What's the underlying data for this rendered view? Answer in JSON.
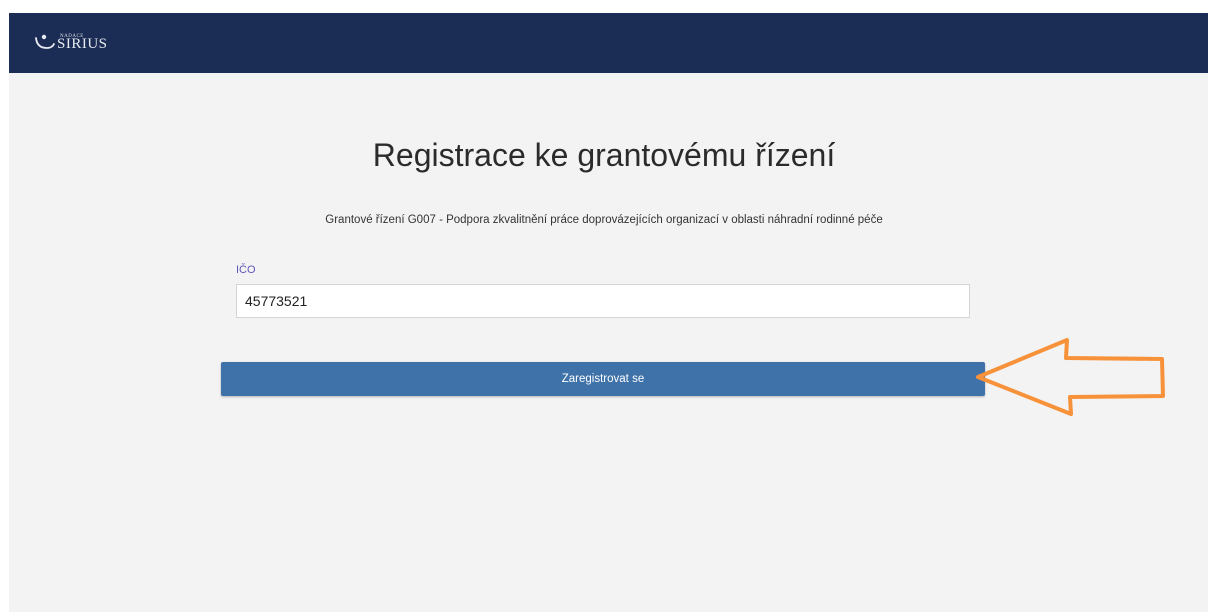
{
  "header": {
    "logo_small": "NADACE",
    "logo_main": "SIRIUS",
    "bg_color": "#1c2d55"
  },
  "main": {
    "title": "Registrace ke grantovému řízení",
    "subtitle": "Grantové řízení G007 - Podpora zkvalitnění práce doprovázejících organizací v oblasti náhradní rodinné péče",
    "ico_label": "IČO",
    "ico_value": "45773521",
    "submit_label": "Zaregistrovat se",
    "button_color": "#3f72a9"
  },
  "annotation": {
    "icon": "arrow-left-icon",
    "color": "#f7923a"
  }
}
